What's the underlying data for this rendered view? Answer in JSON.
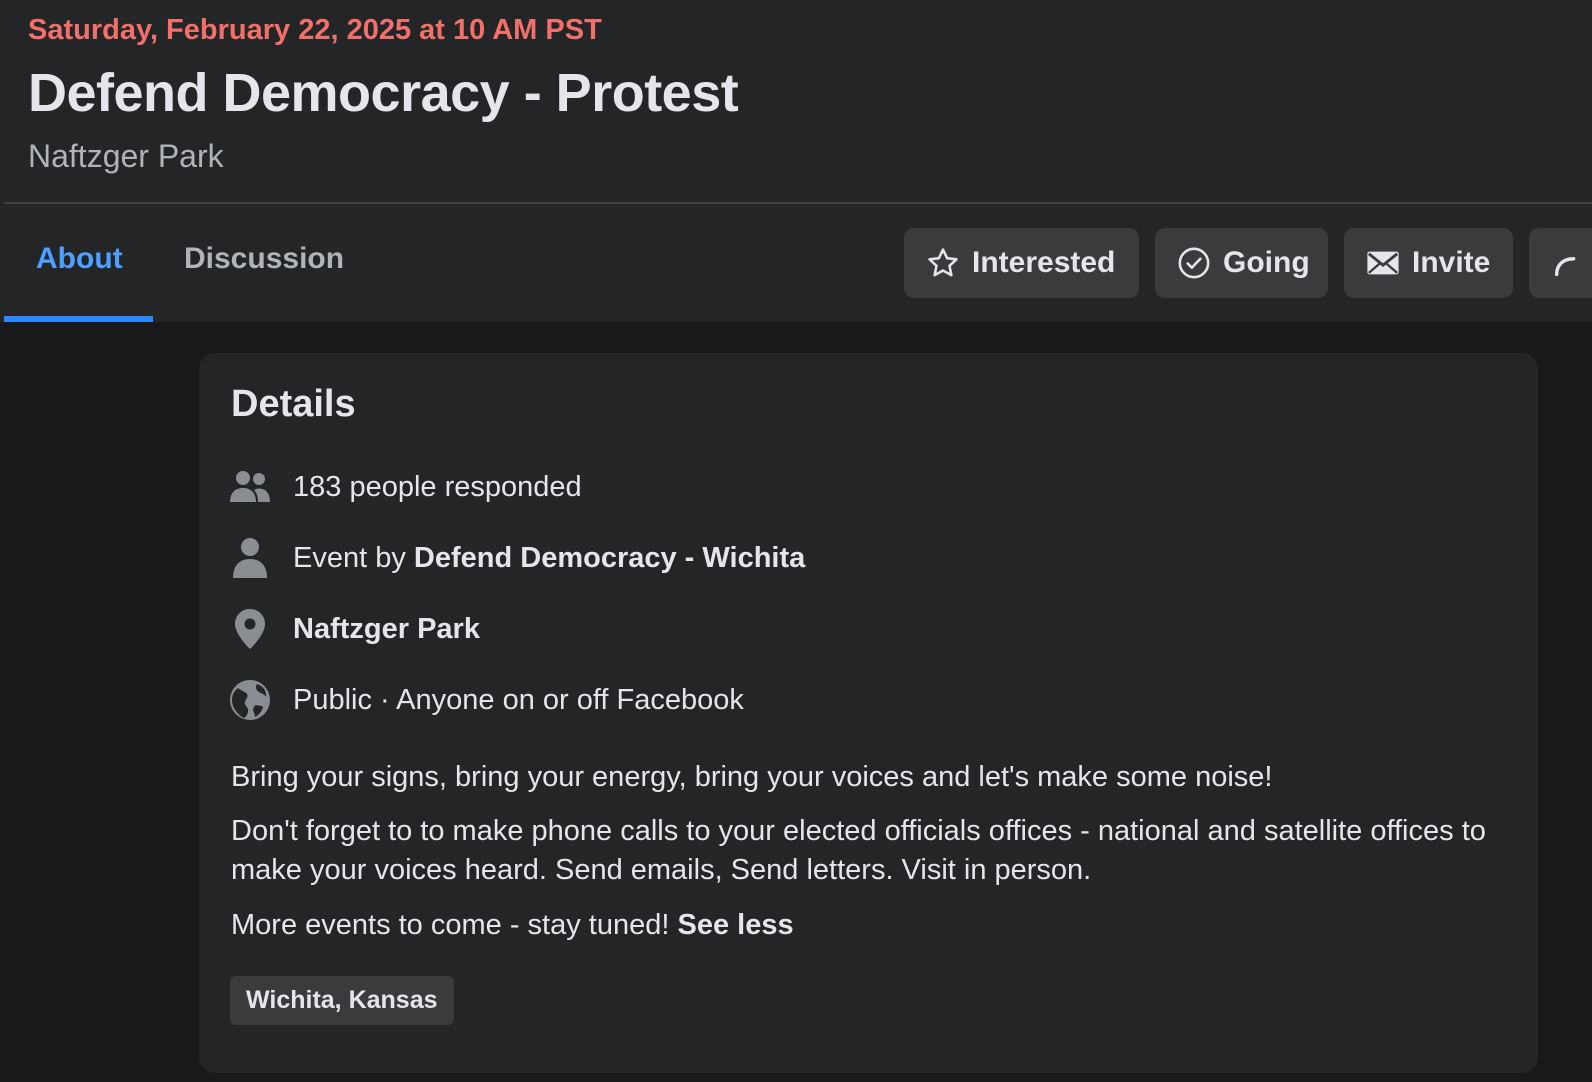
{
  "event": {
    "date": "Saturday, February 22, 2025 at 10 AM PST",
    "title": "Defend Democracy - Protest",
    "location": "Naftzger Park"
  },
  "tabs": [
    {
      "label": "About",
      "active": true
    },
    {
      "label": "Discussion",
      "active": false
    }
  ],
  "actions": {
    "interested": {
      "label": "Interested",
      "icon": "star-icon"
    },
    "going": {
      "label": "Going",
      "icon": "check-circle-icon"
    },
    "invite": {
      "label": "Invite",
      "icon": "envelope-icon"
    },
    "more": {
      "icon": "share-icon"
    }
  },
  "details": {
    "title": "Details",
    "responded": {
      "icon": "people-icon",
      "text": "183 people responded"
    },
    "event_by": {
      "icon": "person-icon",
      "prefix": "Event by ",
      "host": "Defend Democracy - Wichita"
    },
    "place": {
      "icon": "location-pin-icon",
      "text": "Naftzger Park"
    },
    "privacy": {
      "icon": "globe-icon",
      "text": "Public · Anyone on or off Facebook"
    },
    "description": [
      "Bring your signs, bring your energy, bring your voices and let's make some noise!",
      "Don't forget to to make phone calls to your elected officials offices - national and satellite offices to make your voices heard. Send emails, Send letters. Visit in person.",
      "More events to come - stay tuned! "
    ],
    "see_less": "See less",
    "tag": "Wichita, Kansas"
  },
  "colors": {
    "date_accent": "#f3706a",
    "active_tab": "#4e9fff",
    "tab_underline": "#2d88ff",
    "panel_bg": "#242526",
    "page_bg": "#18191a",
    "button_bg": "#3a3b3c"
  }
}
